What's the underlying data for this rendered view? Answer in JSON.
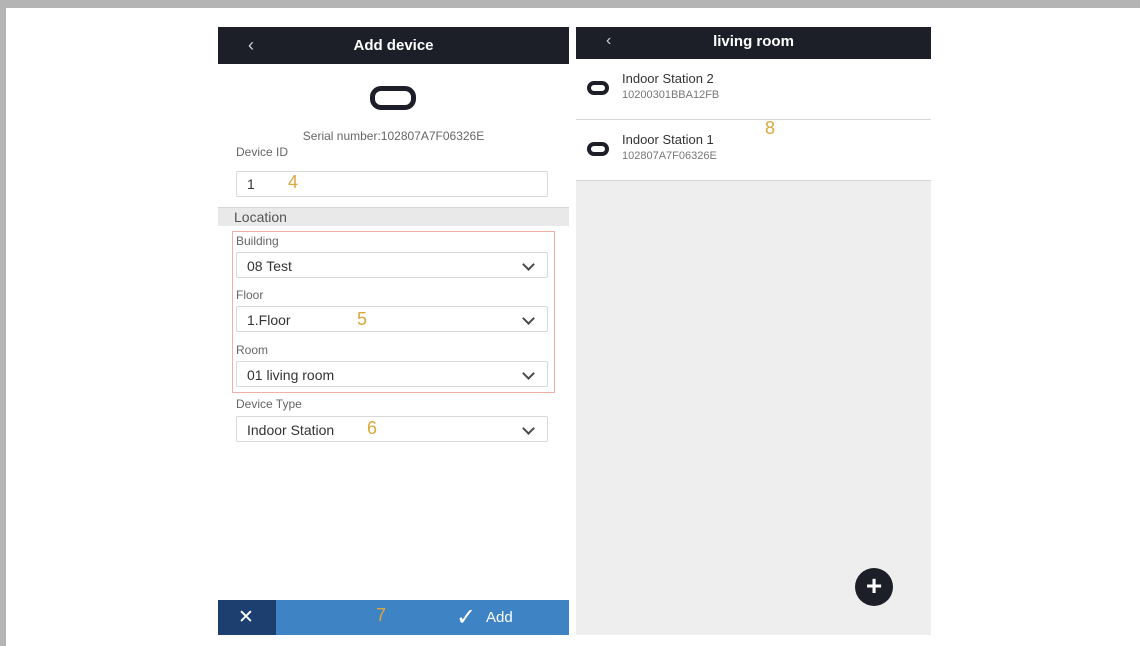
{
  "left_screen": {
    "nav": {
      "back_icon": "‹",
      "title": "Add device"
    },
    "device_icon": "device-icon",
    "serial_text": "Serial number:102807A7F06326E",
    "device_id": {
      "label": "Device ID",
      "value": "1"
    },
    "location": {
      "section_title": "Location",
      "building": {
        "label": "Building",
        "value": "08 Test"
      },
      "floor": {
        "label": "Floor",
        "value": "1.Floor"
      },
      "room": {
        "label": "Room",
        "value": "01 living room"
      }
    },
    "device_type": {
      "label": "Device Type",
      "value": "Indoor Station"
    },
    "bottom": {
      "cancel_icon": "✕",
      "add_check": "✓",
      "add_label": "Add"
    },
    "markers": {
      "m4": "4",
      "m5": "5",
      "m6": "6",
      "m7": "7"
    }
  },
  "right_screen": {
    "nav": {
      "back_icon": "‹",
      "title": "living room"
    },
    "items": [
      {
        "name": "Indoor Station 2",
        "serial": "10200301BBA12FB"
      },
      {
        "name": "Indoor Station 1",
        "serial": "102807A7F06326E"
      }
    ],
    "marker": "8",
    "fab_icon": "+"
  },
  "colors": {
    "navbar": "#1c1f28",
    "add_bar": "#3e83c4",
    "cancel_bar": "#1c3f70",
    "marker": "#d9a83d",
    "highlight_box": "#f1b0a6"
  }
}
